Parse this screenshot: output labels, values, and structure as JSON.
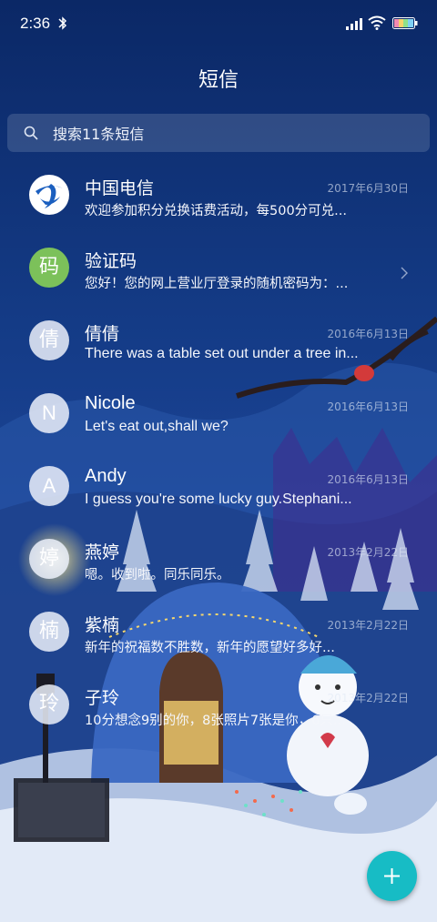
{
  "status_bar": {
    "time": "2:36",
    "icons": [
      "bluetooth-icon",
      "signal-icon",
      "wifi-icon",
      "battery-icon"
    ]
  },
  "title": "短信",
  "search": {
    "placeholder": "搜索11条短信"
  },
  "conversations": [
    {
      "avatar": "",
      "avatar_icon": "china-telecom-logo",
      "name": "中国电信",
      "date": "2017年6月30日",
      "preview": "欢迎参加积分兑换话费活动，每500分可兑..."
    },
    {
      "avatar": "码",
      "name": "验证码",
      "date": "",
      "preview": "您好！您的网上营业厅登录的随机密码为：..."
    },
    {
      "avatar": "倩",
      "name": "倩倩",
      "date": "2016年6月13日",
      "preview": "There was a table set out under a tree in..."
    },
    {
      "avatar": "N",
      "name": "Nicole",
      "date": "2016年6月13日",
      "preview": "Let's eat out,shall we?"
    },
    {
      "avatar": "A",
      "name": "Andy",
      "date": "2016年6月13日",
      "preview": "I guess you're some lucky guy.Stephani..."
    },
    {
      "avatar": "婷",
      "name": "燕婷",
      "date": "2013年2月22日",
      "preview": "嗯。收到啦。同乐同乐。"
    },
    {
      "avatar": "楠",
      "name": "紫楠",
      "date": "2013年2月22日",
      "preview": "新年的祝福数不胜数，新年的愿望好多好..."
    },
    {
      "avatar": "玲",
      "name": "子玲",
      "date": "2013年2月22日",
      "preview": "10分想念9别的你，8张照片7张是你，6只..."
    }
  ],
  "colors": {
    "accent": "#17bcc5",
    "verify_avatar": "#7cc15a",
    "background": "#0d2a63"
  },
  "fab": {
    "icon": "plus-icon"
  }
}
